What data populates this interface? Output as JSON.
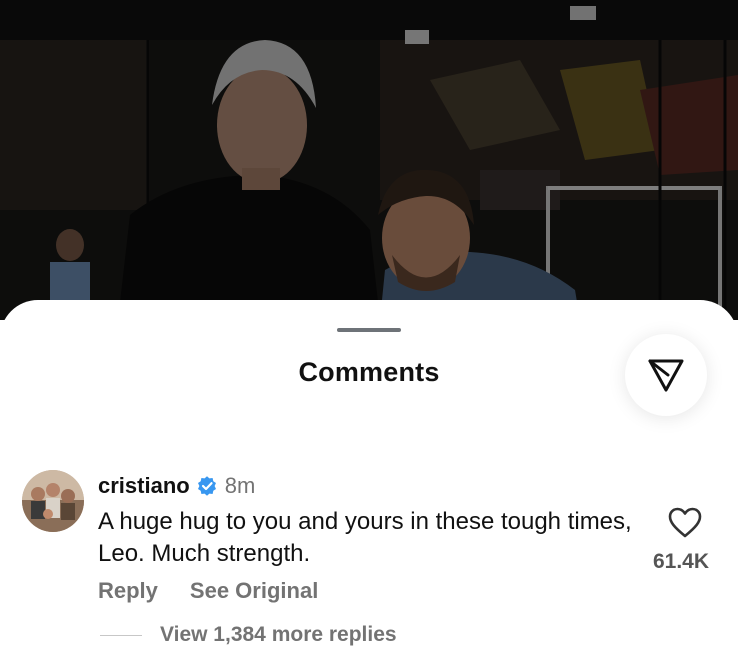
{
  "sheet": {
    "title": "Comments"
  },
  "icons": {
    "share": "paper-plane-icon",
    "verified": "verified-badge-icon",
    "like": "heart-icon"
  },
  "colors": {
    "text_primary": "#111111",
    "text_secondary": "#737373",
    "verified_blue": "#3897f0"
  },
  "comment": {
    "username": "cristiano",
    "time": "8m",
    "text": "A huge hug to you and yours in these tough times, Leo. Much strength.",
    "like_count": "61.4K",
    "reply_label": "Reply",
    "see_original_label": "See Original",
    "view_replies_label": "View 1,384 more replies"
  }
}
